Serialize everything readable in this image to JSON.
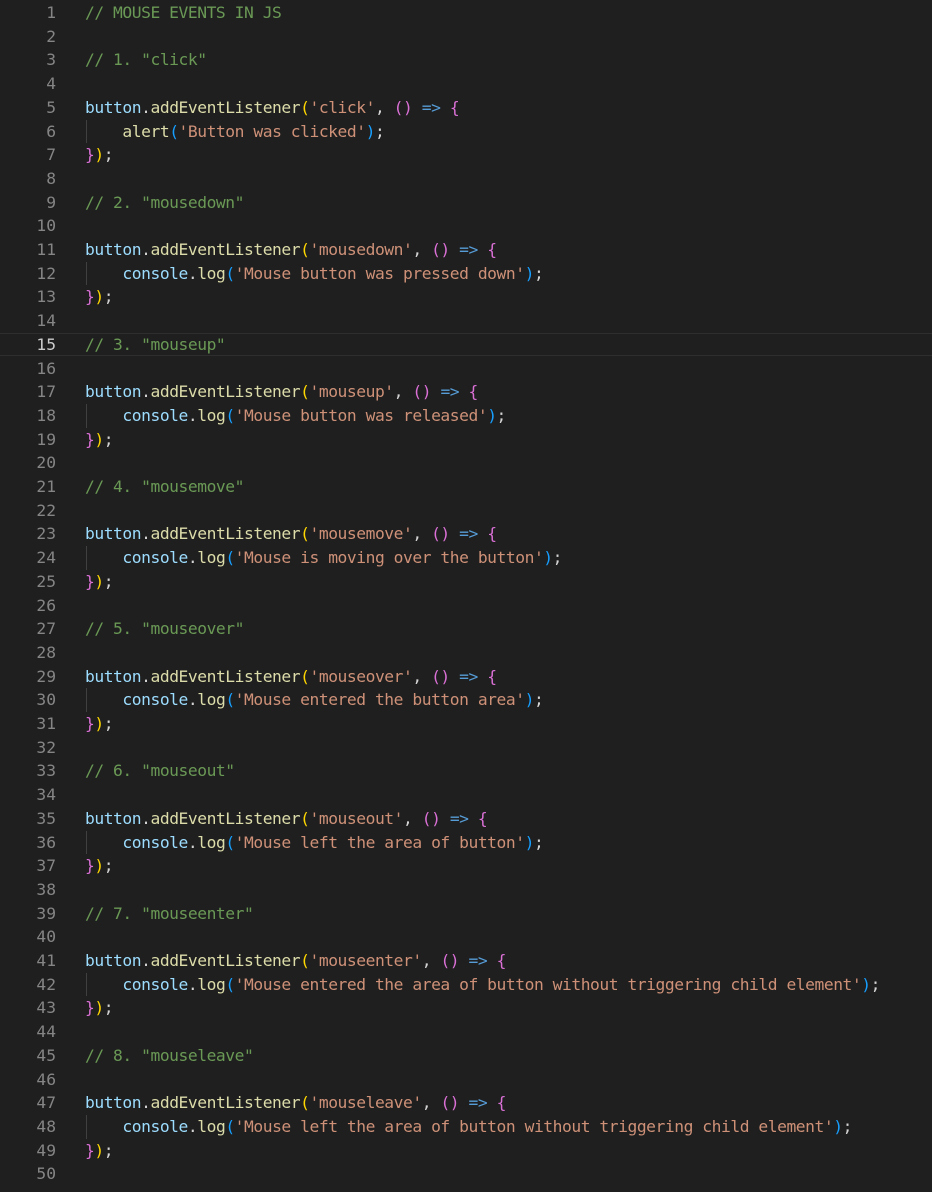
{
  "editor": {
    "active_line": 15,
    "colors": {
      "background": "#1f1f1f",
      "line_number": "#858585",
      "line_number_active": "#cccccc",
      "comment": "#6a9955",
      "variable": "#9cdcfe",
      "function": "#dcdcaa",
      "string": "#ce9178",
      "keyword_arrow": "#569cd6",
      "bracket_level1": "#ffd700",
      "bracket_level2": "#da70d6",
      "bracket_level3": "#179fff"
    },
    "lines": [
      {
        "n": "1",
        "tokens": [
          {
            "t": "c",
            "v": "// MOUSE EVENTS IN JS"
          }
        ]
      },
      {
        "n": "2",
        "tokens": []
      },
      {
        "n": "3",
        "tokens": [
          {
            "t": "c",
            "v": "// 1. \"click\""
          }
        ]
      },
      {
        "n": "4",
        "tokens": []
      },
      {
        "n": "5",
        "tokens": [
          {
            "t": "v",
            "v": "button"
          },
          {
            "t": "p",
            "v": "."
          },
          {
            "t": "f",
            "v": "addEventListener"
          },
          {
            "t": "b1",
            "v": "("
          },
          {
            "t": "s",
            "v": "'click'"
          },
          {
            "t": "p",
            "v": ", "
          },
          {
            "t": "b2",
            "v": "()"
          },
          {
            "t": "p",
            "v": " "
          },
          {
            "t": "k",
            "v": "=>"
          },
          {
            "t": "p",
            "v": " "
          },
          {
            "t": "b2",
            "v": "{"
          }
        ]
      },
      {
        "n": "6",
        "tokens": [
          {
            "t": "p",
            "v": "    "
          },
          {
            "t": "f",
            "v": "alert"
          },
          {
            "t": "b3",
            "v": "("
          },
          {
            "t": "s",
            "v": "'Button was clicked'"
          },
          {
            "t": "b3",
            "v": ")"
          },
          {
            "t": "p",
            "v": ";"
          }
        ]
      },
      {
        "n": "7",
        "tokens": [
          {
            "t": "b2",
            "v": "}"
          },
          {
            "t": "b1",
            "v": ")"
          },
          {
            "t": "p",
            "v": ";"
          }
        ]
      },
      {
        "n": "8",
        "tokens": []
      },
      {
        "n": "9",
        "tokens": [
          {
            "t": "c",
            "v": "// 2. \"mousedown\""
          }
        ]
      },
      {
        "n": "10",
        "tokens": []
      },
      {
        "n": "11",
        "tokens": [
          {
            "t": "v",
            "v": "button"
          },
          {
            "t": "p",
            "v": "."
          },
          {
            "t": "f",
            "v": "addEventListener"
          },
          {
            "t": "b1",
            "v": "("
          },
          {
            "t": "s",
            "v": "'mousedown'"
          },
          {
            "t": "p",
            "v": ", "
          },
          {
            "t": "b2",
            "v": "()"
          },
          {
            "t": "p",
            "v": " "
          },
          {
            "t": "k",
            "v": "=>"
          },
          {
            "t": "p",
            "v": " "
          },
          {
            "t": "b2",
            "v": "{"
          }
        ]
      },
      {
        "n": "12",
        "tokens": [
          {
            "t": "p",
            "v": "    "
          },
          {
            "t": "v",
            "v": "console"
          },
          {
            "t": "p",
            "v": "."
          },
          {
            "t": "f",
            "v": "log"
          },
          {
            "t": "b3",
            "v": "("
          },
          {
            "t": "s",
            "v": "'Mouse button was pressed down'"
          },
          {
            "t": "b3",
            "v": ")"
          },
          {
            "t": "p",
            "v": ";"
          }
        ]
      },
      {
        "n": "13",
        "tokens": [
          {
            "t": "b2",
            "v": "}"
          },
          {
            "t": "b1",
            "v": ")"
          },
          {
            "t": "p",
            "v": ";"
          }
        ]
      },
      {
        "n": "14",
        "tokens": []
      },
      {
        "n": "15",
        "tokens": [
          {
            "t": "c",
            "v": "// 3. \"mouseup\""
          }
        ]
      },
      {
        "n": "16",
        "tokens": []
      },
      {
        "n": "17",
        "tokens": [
          {
            "t": "v",
            "v": "button"
          },
          {
            "t": "p",
            "v": "."
          },
          {
            "t": "f",
            "v": "addEventListener"
          },
          {
            "t": "b1",
            "v": "("
          },
          {
            "t": "s",
            "v": "'mouseup'"
          },
          {
            "t": "p",
            "v": ", "
          },
          {
            "t": "b2",
            "v": "()"
          },
          {
            "t": "p",
            "v": " "
          },
          {
            "t": "k",
            "v": "=>"
          },
          {
            "t": "p",
            "v": " "
          },
          {
            "t": "b2",
            "v": "{"
          }
        ]
      },
      {
        "n": "18",
        "tokens": [
          {
            "t": "p",
            "v": "    "
          },
          {
            "t": "v",
            "v": "console"
          },
          {
            "t": "p",
            "v": "."
          },
          {
            "t": "f",
            "v": "log"
          },
          {
            "t": "b3",
            "v": "("
          },
          {
            "t": "s",
            "v": "'Mouse button was released'"
          },
          {
            "t": "b3",
            "v": ")"
          },
          {
            "t": "p",
            "v": ";"
          }
        ]
      },
      {
        "n": "19",
        "tokens": [
          {
            "t": "b2",
            "v": "}"
          },
          {
            "t": "b1",
            "v": ")"
          },
          {
            "t": "p",
            "v": ";"
          }
        ]
      },
      {
        "n": "20",
        "tokens": []
      },
      {
        "n": "21",
        "tokens": [
          {
            "t": "c",
            "v": "// 4. \"mousemove\""
          }
        ]
      },
      {
        "n": "22",
        "tokens": []
      },
      {
        "n": "23",
        "tokens": [
          {
            "t": "v",
            "v": "button"
          },
          {
            "t": "p",
            "v": "."
          },
          {
            "t": "f",
            "v": "addEventListener"
          },
          {
            "t": "b1",
            "v": "("
          },
          {
            "t": "s",
            "v": "'mousemove'"
          },
          {
            "t": "p",
            "v": ", "
          },
          {
            "t": "b2",
            "v": "()"
          },
          {
            "t": "p",
            "v": " "
          },
          {
            "t": "k",
            "v": "=>"
          },
          {
            "t": "p",
            "v": " "
          },
          {
            "t": "b2",
            "v": "{"
          }
        ]
      },
      {
        "n": "24",
        "tokens": [
          {
            "t": "p",
            "v": "    "
          },
          {
            "t": "v",
            "v": "console"
          },
          {
            "t": "p",
            "v": "."
          },
          {
            "t": "f",
            "v": "log"
          },
          {
            "t": "b3",
            "v": "("
          },
          {
            "t": "s",
            "v": "'Mouse is moving over the button'"
          },
          {
            "t": "b3",
            "v": ")"
          },
          {
            "t": "p",
            "v": ";"
          }
        ]
      },
      {
        "n": "25",
        "tokens": [
          {
            "t": "b2",
            "v": "}"
          },
          {
            "t": "b1",
            "v": ")"
          },
          {
            "t": "p",
            "v": ";"
          }
        ]
      },
      {
        "n": "26",
        "tokens": []
      },
      {
        "n": "27",
        "tokens": [
          {
            "t": "c",
            "v": "// 5. \"mouseover\""
          }
        ]
      },
      {
        "n": "28",
        "tokens": []
      },
      {
        "n": "29",
        "tokens": [
          {
            "t": "v",
            "v": "button"
          },
          {
            "t": "p",
            "v": "."
          },
          {
            "t": "f",
            "v": "addEventListener"
          },
          {
            "t": "b1",
            "v": "("
          },
          {
            "t": "s",
            "v": "'mouseover'"
          },
          {
            "t": "p",
            "v": ", "
          },
          {
            "t": "b2",
            "v": "()"
          },
          {
            "t": "p",
            "v": " "
          },
          {
            "t": "k",
            "v": "=>"
          },
          {
            "t": "p",
            "v": " "
          },
          {
            "t": "b2",
            "v": "{"
          }
        ]
      },
      {
        "n": "30",
        "tokens": [
          {
            "t": "p",
            "v": "    "
          },
          {
            "t": "v",
            "v": "console"
          },
          {
            "t": "p",
            "v": "."
          },
          {
            "t": "f",
            "v": "log"
          },
          {
            "t": "b3",
            "v": "("
          },
          {
            "t": "s",
            "v": "'Mouse entered the button area'"
          },
          {
            "t": "b3",
            "v": ")"
          },
          {
            "t": "p",
            "v": ";"
          }
        ]
      },
      {
        "n": "31",
        "tokens": [
          {
            "t": "b2",
            "v": "}"
          },
          {
            "t": "b1",
            "v": ")"
          },
          {
            "t": "p",
            "v": ";"
          }
        ]
      },
      {
        "n": "32",
        "tokens": []
      },
      {
        "n": "33",
        "tokens": [
          {
            "t": "c",
            "v": "// 6. \"mouseout\""
          }
        ]
      },
      {
        "n": "34",
        "tokens": []
      },
      {
        "n": "35",
        "tokens": [
          {
            "t": "v",
            "v": "button"
          },
          {
            "t": "p",
            "v": "."
          },
          {
            "t": "f",
            "v": "addEventListener"
          },
          {
            "t": "b1",
            "v": "("
          },
          {
            "t": "s",
            "v": "'mouseout'"
          },
          {
            "t": "p",
            "v": ", "
          },
          {
            "t": "b2",
            "v": "()"
          },
          {
            "t": "p",
            "v": " "
          },
          {
            "t": "k",
            "v": "=>"
          },
          {
            "t": "p",
            "v": " "
          },
          {
            "t": "b2",
            "v": "{"
          }
        ]
      },
      {
        "n": "36",
        "tokens": [
          {
            "t": "p",
            "v": "    "
          },
          {
            "t": "v",
            "v": "console"
          },
          {
            "t": "p",
            "v": "."
          },
          {
            "t": "f",
            "v": "log"
          },
          {
            "t": "b3",
            "v": "("
          },
          {
            "t": "s",
            "v": "'Mouse left the area of button'"
          },
          {
            "t": "b3",
            "v": ")"
          },
          {
            "t": "p",
            "v": ";"
          }
        ]
      },
      {
        "n": "37",
        "tokens": [
          {
            "t": "b2",
            "v": "}"
          },
          {
            "t": "b1",
            "v": ")"
          },
          {
            "t": "p",
            "v": ";"
          }
        ]
      },
      {
        "n": "38",
        "tokens": []
      },
      {
        "n": "39",
        "tokens": [
          {
            "t": "c",
            "v": "// 7. \"mouseenter\""
          }
        ]
      },
      {
        "n": "40",
        "tokens": []
      },
      {
        "n": "41",
        "tokens": [
          {
            "t": "v",
            "v": "button"
          },
          {
            "t": "p",
            "v": "."
          },
          {
            "t": "f",
            "v": "addEventListener"
          },
          {
            "t": "b1",
            "v": "("
          },
          {
            "t": "s",
            "v": "'mouseenter'"
          },
          {
            "t": "p",
            "v": ", "
          },
          {
            "t": "b2",
            "v": "()"
          },
          {
            "t": "p",
            "v": " "
          },
          {
            "t": "k",
            "v": "=>"
          },
          {
            "t": "p",
            "v": " "
          },
          {
            "t": "b2",
            "v": "{"
          }
        ]
      },
      {
        "n": "42",
        "tokens": [
          {
            "t": "p",
            "v": "    "
          },
          {
            "t": "v",
            "v": "console"
          },
          {
            "t": "p",
            "v": "."
          },
          {
            "t": "f",
            "v": "log"
          },
          {
            "t": "b3",
            "v": "("
          },
          {
            "t": "s",
            "v": "'Mouse entered the area of button without triggering child element'"
          },
          {
            "t": "b3",
            "v": ")"
          },
          {
            "t": "p",
            "v": ";"
          }
        ]
      },
      {
        "n": "43",
        "tokens": [
          {
            "t": "b2",
            "v": "}"
          },
          {
            "t": "b1",
            "v": ")"
          },
          {
            "t": "p",
            "v": ";"
          }
        ]
      },
      {
        "n": "44",
        "tokens": []
      },
      {
        "n": "45",
        "tokens": [
          {
            "t": "c",
            "v": "// 8. \"mouseleave\""
          }
        ]
      },
      {
        "n": "46",
        "tokens": []
      },
      {
        "n": "47",
        "tokens": [
          {
            "t": "v",
            "v": "button"
          },
          {
            "t": "p",
            "v": "."
          },
          {
            "t": "f",
            "v": "addEventListener"
          },
          {
            "t": "b1",
            "v": "("
          },
          {
            "t": "s",
            "v": "'mouseleave'"
          },
          {
            "t": "p",
            "v": ", "
          },
          {
            "t": "b2",
            "v": "()"
          },
          {
            "t": "p",
            "v": " "
          },
          {
            "t": "k",
            "v": "=>"
          },
          {
            "t": "p",
            "v": " "
          },
          {
            "t": "b2",
            "v": "{"
          }
        ]
      },
      {
        "n": "48",
        "tokens": [
          {
            "t": "p",
            "v": "    "
          },
          {
            "t": "v",
            "v": "console"
          },
          {
            "t": "p",
            "v": "."
          },
          {
            "t": "f",
            "v": "log"
          },
          {
            "t": "b3",
            "v": "("
          },
          {
            "t": "s",
            "v": "'Mouse left the area of button without triggering child element'"
          },
          {
            "t": "b3",
            "v": ")"
          },
          {
            "t": "p",
            "v": ";"
          }
        ]
      },
      {
        "n": "49",
        "tokens": [
          {
            "t": "b2",
            "v": "}"
          },
          {
            "t": "b1",
            "v": ")"
          },
          {
            "t": "p",
            "v": ";"
          }
        ]
      },
      {
        "n": "50",
        "tokens": []
      }
    ]
  }
}
